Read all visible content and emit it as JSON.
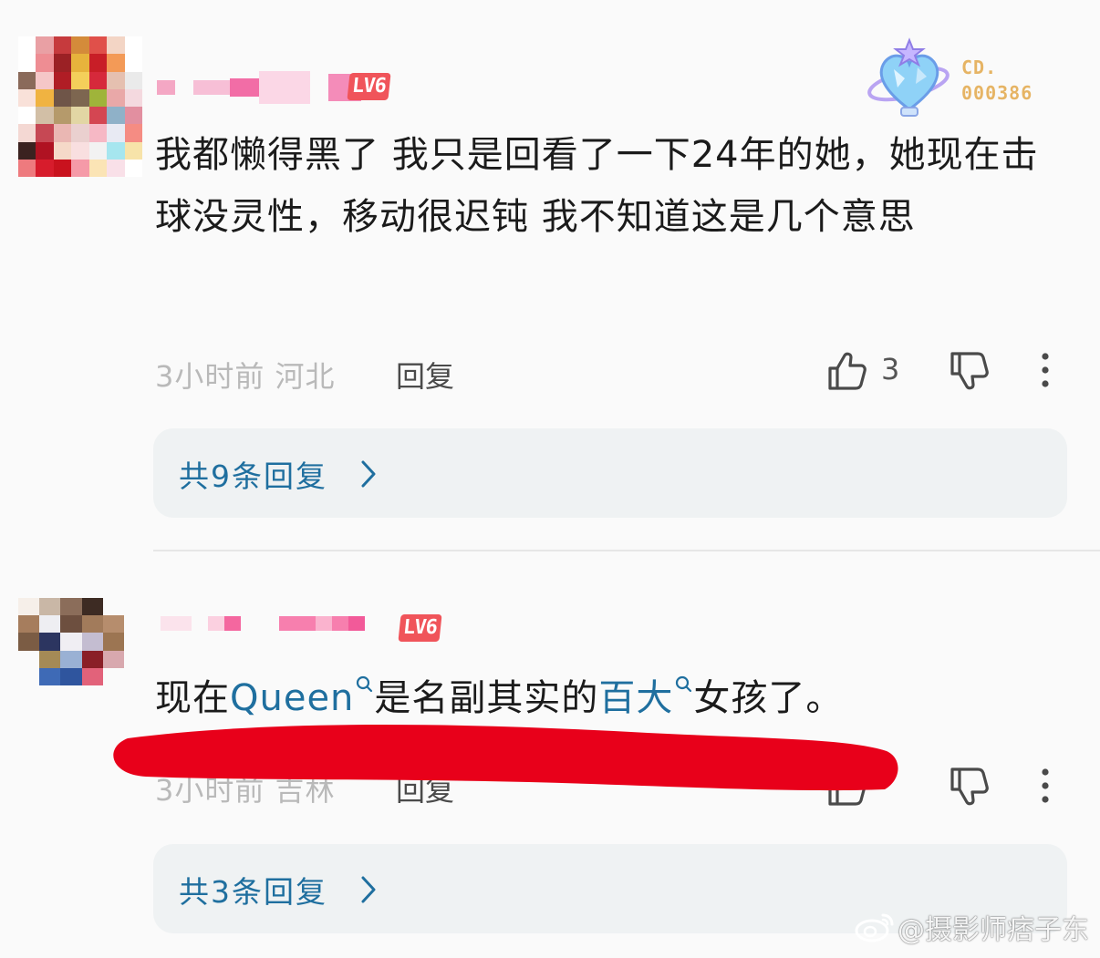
{
  "comments": [
    {
      "level_badge": "LV6",
      "text": "我都懒得黑了  我只是回看了一下24年的她，她现在击球没灵性，移动很迟钝  我不知道这是几个意思",
      "time_location": "3小时前 河北",
      "reply_label": "回复",
      "like_count": "3",
      "replies_link": "共9条回复"
    },
    {
      "level_badge": "LV6",
      "text_parts": [
        "现在",
        "Queen",
        "是名副其实的",
        "百大",
        "女孩了。"
      ],
      "time_location": "3小时前 吉林",
      "reply_label": "回复",
      "replies_link": "共3条回复"
    }
  ],
  "fan_badge": {
    "line1": "CD.",
    "line2": "000386"
  },
  "watermark": "@摄影师痞子东",
  "colors": {
    "link": "#1f6f9f",
    "level_badge": "#f0545a",
    "meta_gray": "#b9b9b9",
    "reply_box_bg": "#eff2f3",
    "redaction": "#e8001a"
  },
  "icons": [
    "thumbs-up-icon",
    "thumbs-down-icon",
    "more-vertical-icon",
    "chevron-right-icon",
    "search-icon",
    "weibo-logo-icon"
  ]
}
